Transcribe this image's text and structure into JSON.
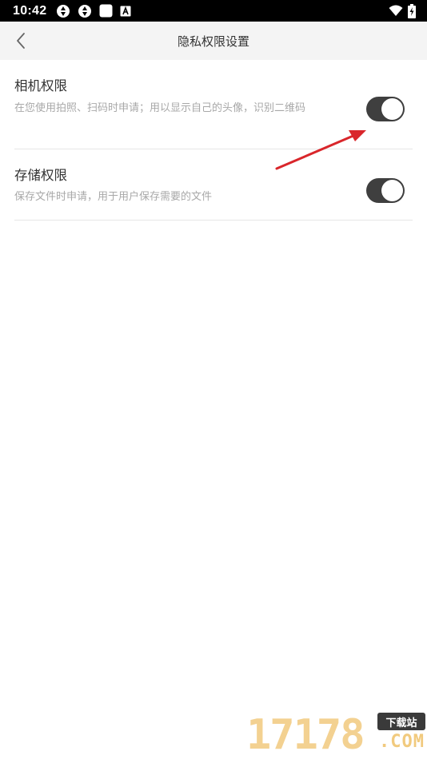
{
  "status_bar": {
    "time": "10:42",
    "icons_left": [
      "sync-icon",
      "sync-icon",
      "notification-square-icon",
      "keyboard-a-icon"
    ],
    "icons_right": [
      "wifi-icon",
      "battery-charging-icon"
    ]
  },
  "nav": {
    "title": "隐私权限设置",
    "back_icon": "chevron-left-icon"
  },
  "permissions": [
    {
      "title": "相机权限",
      "description": "在您使用拍照、扫码时申请；用以显示自己的头像，识别二维码",
      "enabled": true
    },
    {
      "title": "存储权限",
      "description": "保存文件时申请，用于用户保存需要的文件",
      "enabled": true
    }
  ],
  "colors": {
    "toggle_on": "#3f3f3f",
    "annotation_arrow": "#d9262b",
    "nav_background": "#f4f4f4"
  },
  "watermark": {
    "digits": "17178",
    "badge": "下载站",
    "suffix": ".COM"
  }
}
